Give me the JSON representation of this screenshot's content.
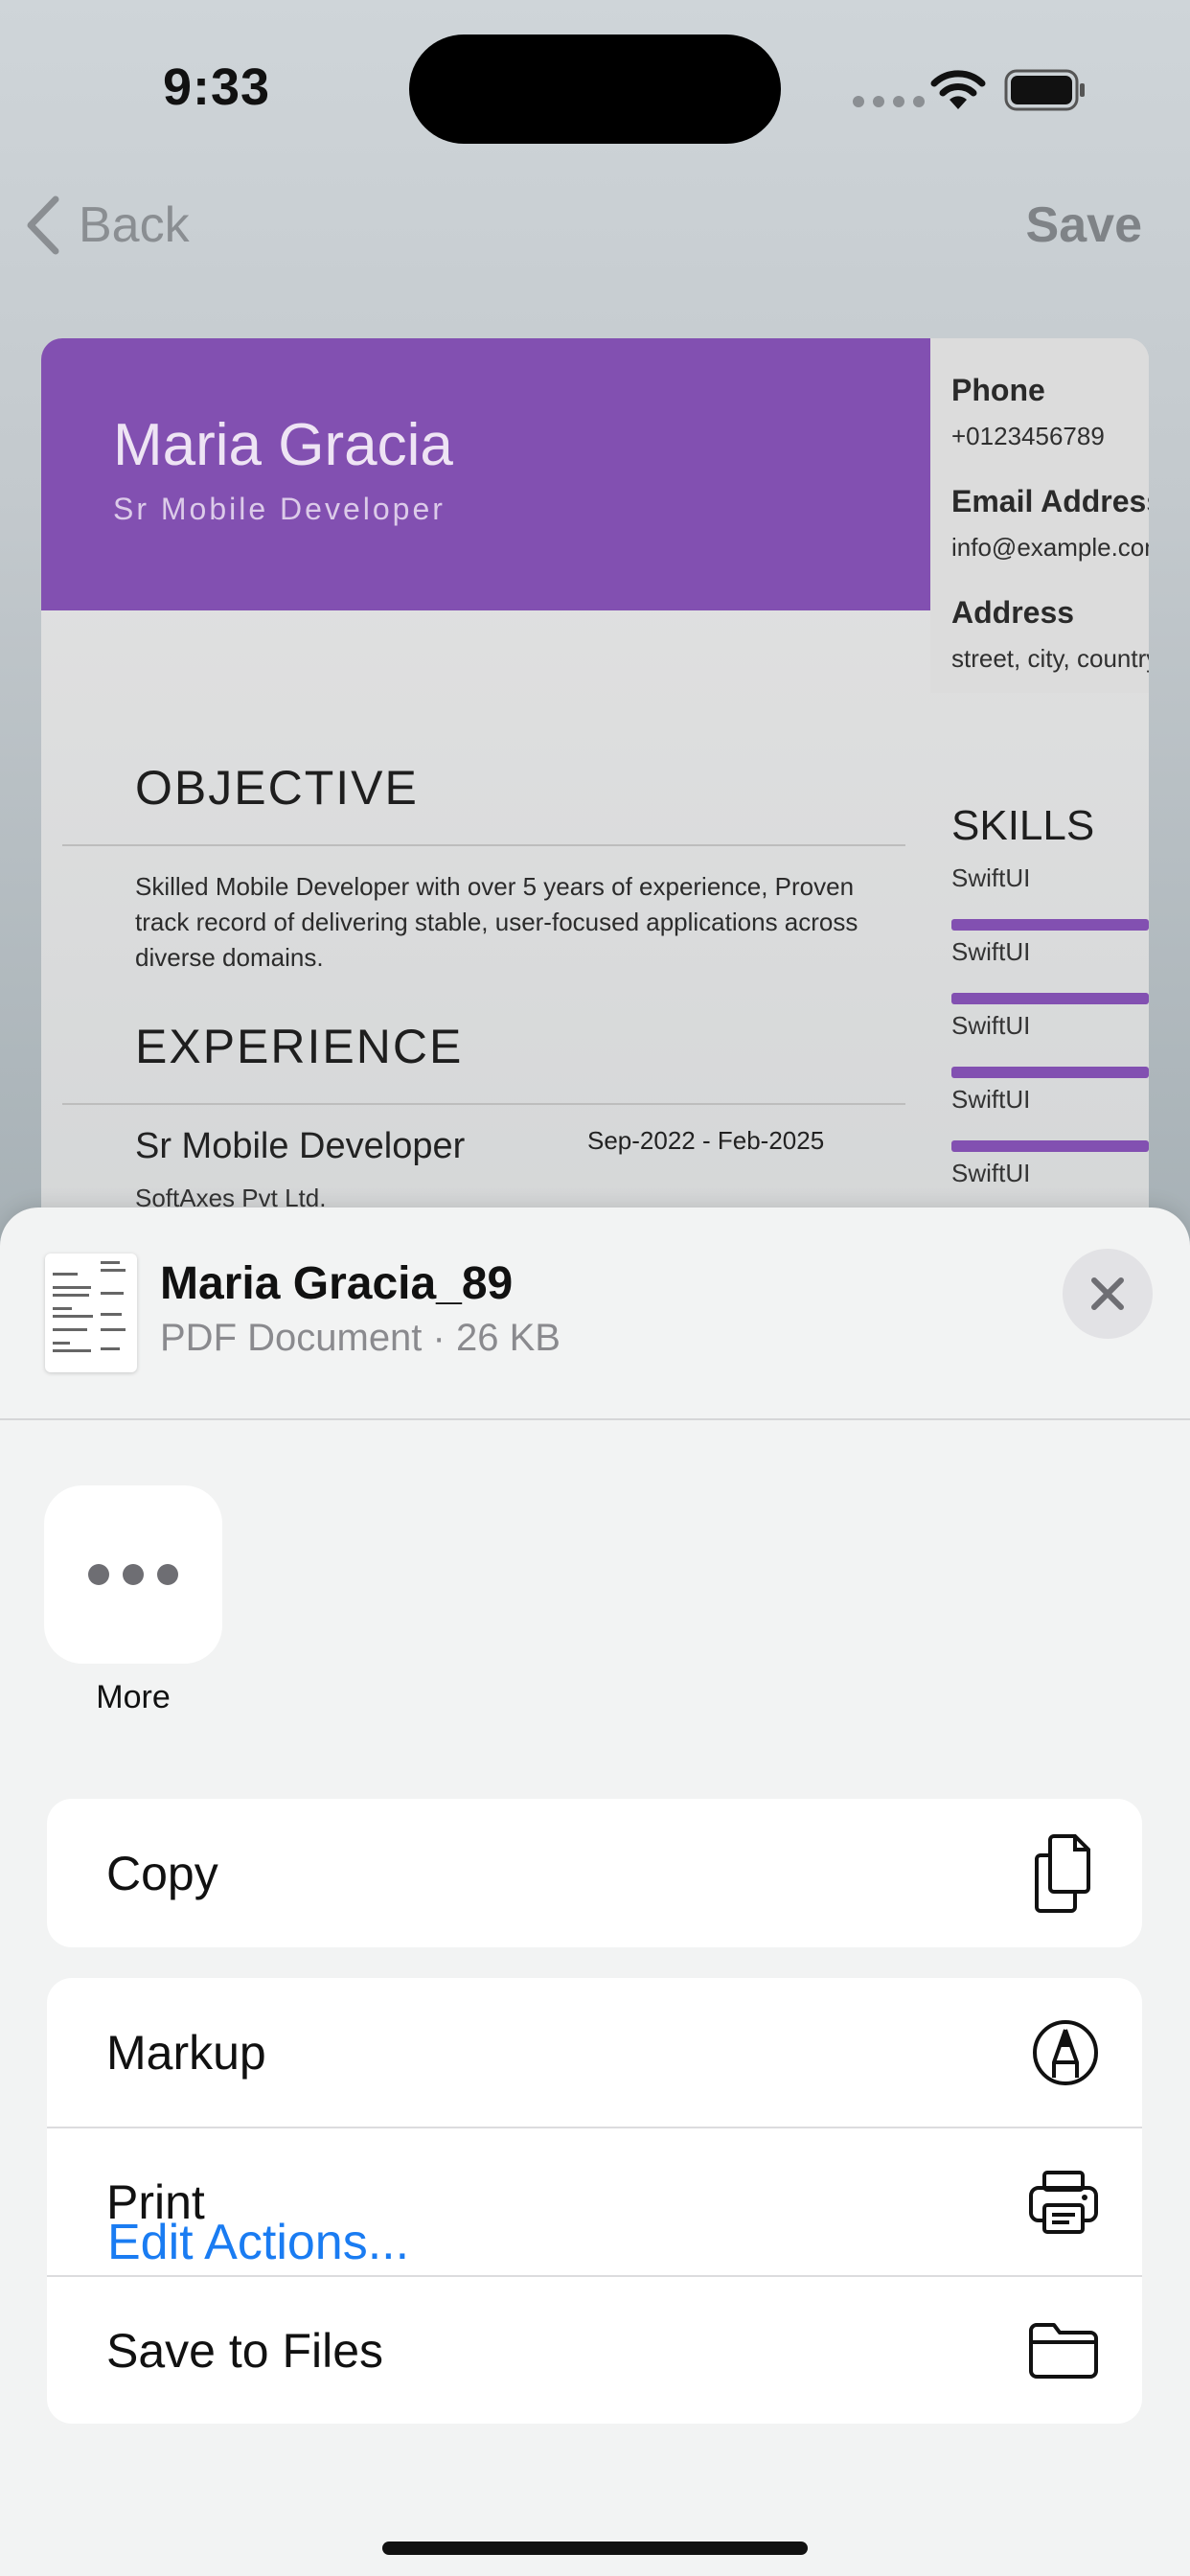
{
  "status_bar": {
    "time": "9:33"
  },
  "nav": {
    "back_label": "Back",
    "save_label": "Save"
  },
  "resume": {
    "name": "Maria Gracia",
    "role": "Sr Mobile Developer",
    "contact": [
      {
        "label": "Phone",
        "value": "+0123456789"
      },
      {
        "label": "Email Address",
        "value": "info@example.com"
      },
      {
        "label": "Address",
        "value": "street, city, country"
      }
    ],
    "objective_title": "OBJECTIVE",
    "objective_text": "Skilled Mobile Developer with over 5 years of experience, Proven track record of delivering stable, user-focused applications across diverse domains.",
    "experience_title": "EXPERIENCE",
    "job_title": "Sr Mobile Developer",
    "job_dates": "Sep-2022 - Feb-2025",
    "company": "SoftAxes Pvt Ltd.",
    "skills_title": "SKILLS",
    "skills": [
      "SwiftUI",
      "SwiftUI",
      "SwiftUI",
      "SwiftUI",
      "SwiftUI"
    ],
    "accent_color": "#8250b1"
  },
  "share_sheet": {
    "doc_name": "Maria Gracia_89",
    "doc_meta": "PDF Document · 26 KB",
    "more_label": "More",
    "actions_group1": [
      {
        "label": "Copy",
        "icon": "copy-icon"
      }
    ],
    "actions_group2": [
      {
        "label": "Markup",
        "icon": "markup-icon"
      },
      {
        "label": "Print",
        "icon": "printer-icon"
      },
      {
        "label": "Save to Files",
        "icon": "folder-icon"
      }
    ],
    "edit_actions": "Edit Actions...",
    "link_color": "#1a7cf2"
  }
}
